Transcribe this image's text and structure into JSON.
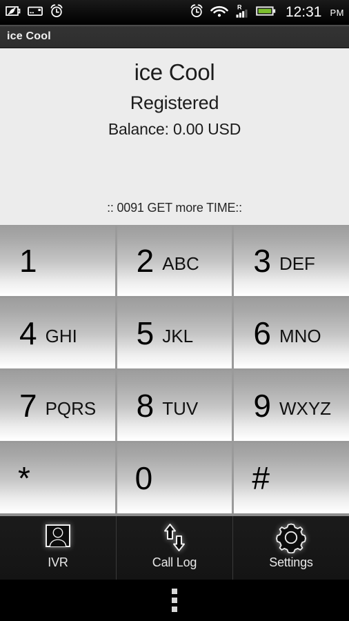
{
  "status_bar": {
    "left_icons": [
      {
        "name": "eco-battery-icon",
        "label": "eco mode"
      },
      {
        "name": "sd-card-icon",
        "label": "storage card"
      },
      {
        "name": "alarm-clock-icon",
        "label": "alarm set"
      }
    ],
    "right_icons": [
      {
        "name": "alarm-clock-icon",
        "label": "alarm"
      },
      {
        "name": "wifi-icon",
        "label": "wifi connected"
      },
      {
        "name": "signal-roaming-icon",
        "label": "R",
        "roaming_letter": "R"
      },
      {
        "name": "battery-icon",
        "label": "battery charged",
        "color": "#7CBF2E"
      }
    ],
    "clock": "12:31",
    "ampm": "PM"
  },
  "title_bar": {
    "title": "ice Cool"
  },
  "info_panel": {
    "account_name": "ice Cool",
    "registration_status": "Registered",
    "balance": "Balance: 0.00 USD",
    "promo_banner": ":: 0091 GET more TIME::"
  },
  "keypad": {
    "rows": [
      [
        {
          "digit": "1",
          "letters": ""
        },
        {
          "digit": "2",
          "letters": "ABC"
        },
        {
          "digit": "3",
          "letters": "DEF"
        }
      ],
      [
        {
          "digit": "4",
          "letters": "GHI"
        },
        {
          "digit": "5",
          "letters": "JKL"
        },
        {
          "digit": "6",
          "letters": "MNO"
        }
      ],
      [
        {
          "digit": "7",
          "letters": "PQRS"
        },
        {
          "digit": "8",
          "letters": "TUV"
        },
        {
          "digit": "9",
          "letters": "WXYZ"
        }
      ],
      [
        {
          "digit": "*",
          "letters": ""
        },
        {
          "digit": "0",
          "letters": ""
        },
        {
          "digit": "#",
          "letters": ""
        }
      ]
    ]
  },
  "tab_bar": {
    "tabs": [
      {
        "label": "IVR",
        "icon": "contact-person-icon"
      },
      {
        "label": "Call Log",
        "icon": "call-log-arrows-icon"
      },
      {
        "label": "Settings",
        "icon": "gear-icon"
      }
    ]
  },
  "nav_bar": {
    "overflow_icon": "overflow-menu-icon"
  },
  "colors": {
    "background": "#ECECEC",
    "title_bar": "#333333",
    "keypad_divider": "#9A9A9A",
    "tab_bar": "#111111",
    "battery_green": "#7CBF2E"
  }
}
